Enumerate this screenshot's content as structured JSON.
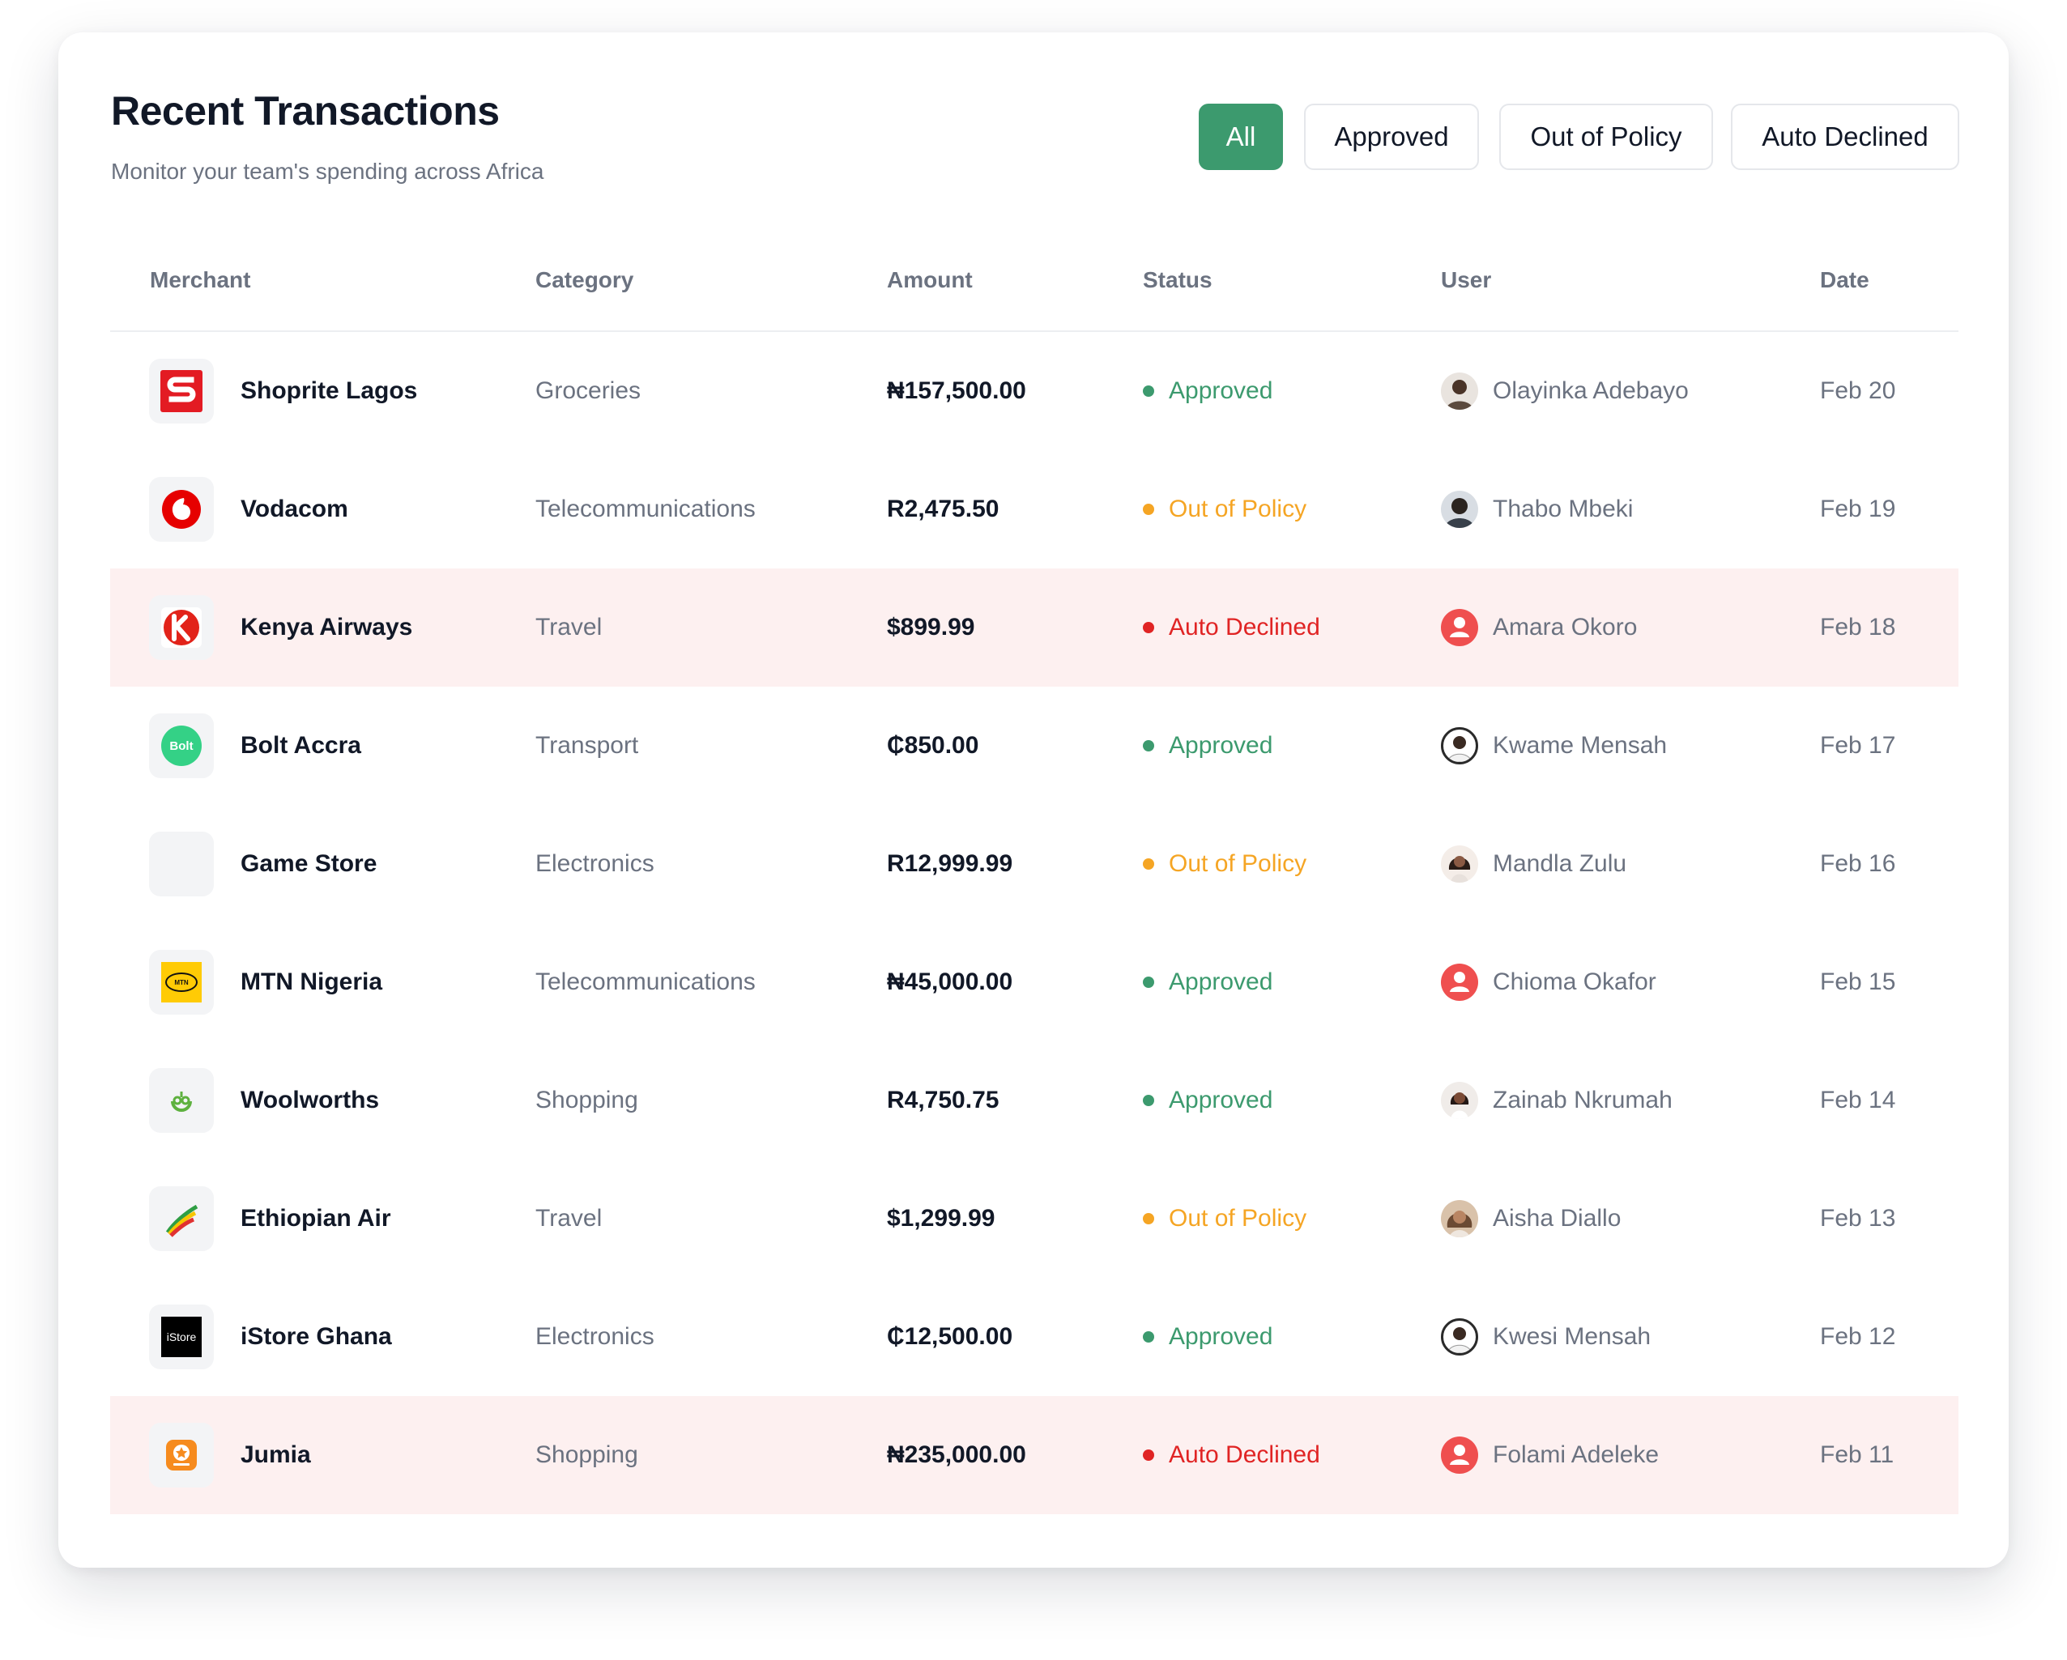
{
  "header": {
    "title": "Recent Transactions",
    "subtitle": "Monitor your team's spending across Africa"
  },
  "filters": [
    {
      "label": "All",
      "active": true
    },
    {
      "label": "Approved",
      "active": false
    },
    {
      "label": "Out of Policy",
      "active": false
    },
    {
      "label": "Auto Declined",
      "active": false
    }
  ],
  "columns": {
    "merchant": "Merchant",
    "category": "Category",
    "amount": "Amount",
    "status": "Status",
    "user": "User",
    "date": "Date"
  },
  "colors": {
    "accent": "#3c9a6e",
    "approved": "#3c9a6e",
    "out_of_policy": "#f5a524",
    "auto_declined": "#e02424",
    "declined_row_bg": "#fdf0f0"
  },
  "transactions": [
    {
      "merchant": "Shoprite Lagos",
      "logo": "shoprite-logo",
      "category": "Groceries",
      "amount": "₦157,500.00",
      "status": "Approved",
      "user": "Olayinka Adebayo",
      "avatar": "photo-avatar",
      "date": "Feb 20"
    },
    {
      "merchant": "Vodacom",
      "logo": "vodacom-logo",
      "category": "Telecommunications",
      "amount": "R2,475.50",
      "status": "Out of Policy",
      "user": "Thabo Mbeki",
      "avatar": "photo-avatar",
      "date": "Feb 19"
    },
    {
      "merchant": "Kenya Airways",
      "logo": "kenya-airways-logo",
      "category": "Travel",
      "amount": "$899.99",
      "status": "Auto Declined",
      "user": "Amara Okoro",
      "avatar": "default-user-icon",
      "date": "Feb 18"
    },
    {
      "merchant": "Bolt Accra",
      "logo": "bolt-logo",
      "category": "Transport",
      "amount": "₵850.00",
      "status": "Approved",
      "user": "Kwame Mensah",
      "avatar": "photo-avatar",
      "date": "Feb 17"
    },
    {
      "merchant": "Game Store",
      "logo": "blank-logo",
      "category": "Electronics",
      "amount": "R12,999.99",
      "status": "Out of Policy",
      "user": "Mandla Zulu",
      "avatar": "photo-avatar",
      "date": "Feb 16"
    },
    {
      "merchant": "MTN Nigeria",
      "logo": "mtn-logo",
      "category": "Telecommunications",
      "amount": "₦45,000.00",
      "status": "Approved",
      "user": "Chioma Okafor",
      "avatar": "default-user-icon",
      "date": "Feb 15"
    },
    {
      "merchant": "Woolworths",
      "logo": "woolworths-logo",
      "category": "Shopping",
      "amount": "R4,750.75",
      "status": "Approved",
      "user": "Zainab Nkrumah",
      "avatar": "photo-avatar",
      "date": "Feb 14"
    },
    {
      "merchant": "Ethiopian Air",
      "logo": "ethiopian-logo",
      "category": "Travel",
      "amount": "$1,299.99",
      "status": "Out of Policy",
      "user": "Aisha Diallo",
      "avatar": "photo-avatar",
      "date": "Feb 13"
    },
    {
      "merchant": "iStore Ghana",
      "logo": "istore-logo",
      "category": "Electronics",
      "amount": "₵12,500.00",
      "status": "Approved",
      "user": "Kwesi Mensah",
      "avatar": "photo-avatar",
      "date": "Feb 12"
    },
    {
      "merchant": "Jumia",
      "logo": "jumia-logo",
      "category": "Shopping",
      "amount": "₦235,000.00",
      "status": "Auto Declined",
      "user": "Folami Adeleke",
      "avatar": "default-user-icon",
      "date": "Feb 11"
    }
  ],
  "logo_text": {
    "bolt": "Bolt",
    "mtn": "MTN",
    "istore": "iStore"
  }
}
